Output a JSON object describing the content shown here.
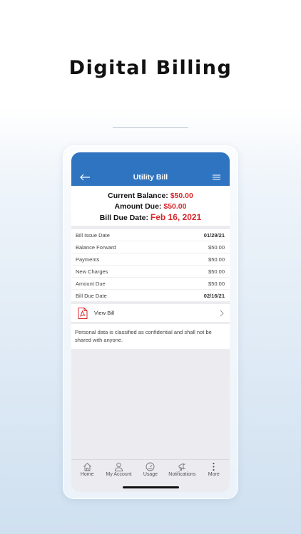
{
  "headline": "Digital Billing",
  "header": {
    "title": "Utility Bill",
    "back_icon": "back-arrow-icon",
    "menu_icon": "hamburger-menu-icon"
  },
  "summary": {
    "current_balance_label": "Current Balance:",
    "current_balance_value": "$50.00",
    "amount_due_label": "Amount Due:",
    "amount_due_value": "$50.00",
    "due_date_label": "Bill Due Date:",
    "due_date_value": "Feb 16, 2021"
  },
  "details": [
    {
      "label": "Bill Issue Date",
      "value": "01/29/21"
    },
    {
      "label": "Balance Forward",
      "value": "$50.00"
    },
    {
      "label": "Payments",
      "value": "$50.00"
    },
    {
      "label": "New Charges",
      "value": "$50.00"
    },
    {
      "label": "Amount Due",
      "value": "$50.00"
    },
    {
      "label": "Bill Due Date",
      "value": "02/16/21"
    }
  ],
  "view_bill": {
    "label": "View Bill",
    "icon": "pdf-icon"
  },
  "note": "Personal data is classified as confidential and shall not be shared with anyone.",
  "tabs": [
    {
      "label": "Home",
      "icon": "home-icon"
    },
    {
      "label": "My Account",
      "icon": "user-icon"
    },
    {
      "label": "Usage",
      "icon": "gauge-icon"
    },
    {
      "label": "Notifications",
      "icon": "megaphone-icon"
    },
    {
      "label": "More",
      "icon": "more-vertical-icon"
    }
  ],
  "colors": {
    "brand_blue": "#2f74c0",
    "accent_red": "#d8262b"
  }
}
